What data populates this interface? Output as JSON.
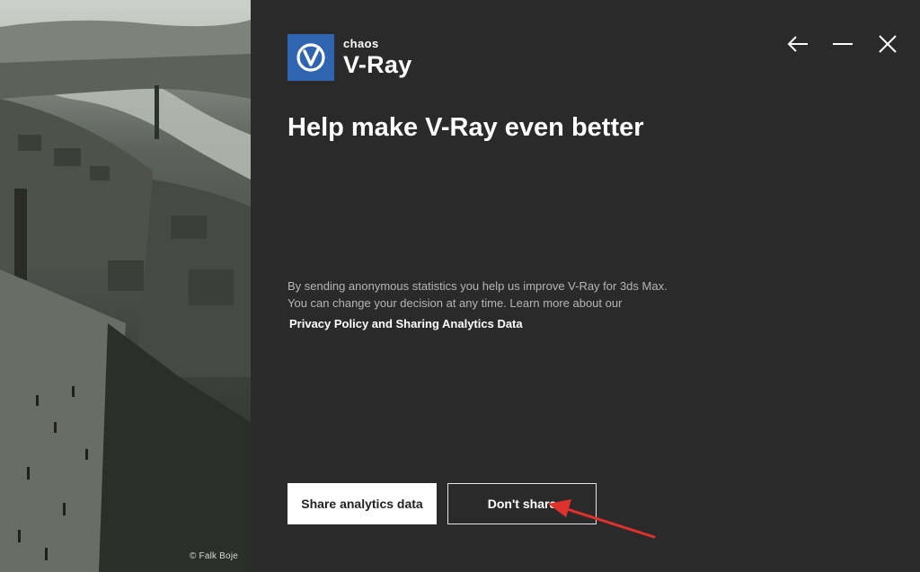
{
  "side_panel": {
    "credit": "© Falk Boje"
  },
  "header": {
    "brand_small": "chaos",
    "brand_big": "V-Ray",
    "logo_icon": "vray-logo-icon",
    "controls": [
      "back-arrow-icon",
      "minimize-icon",
      "close-icon"
    ]
  },
  "content": {
    "headline": "Help make V-Ray even better",
    "line1": "By sending anonymous statistics you help us improve V-Ray for 3ds Max.",
    "line2": "You can change your decision at any time. Learn more about our",
    "link": "Privacy Policy and Sharing Analytics Data"
  },
  "actions": {
    "share_label": "Share analytics data",
    "dont_share_label": "Don't share"
  },
  "colors": {
    "background": "#2a2a2a",
    "logo_blue": "#2f64b0",
    "annotation_red": "#e0322c"
  }
}
